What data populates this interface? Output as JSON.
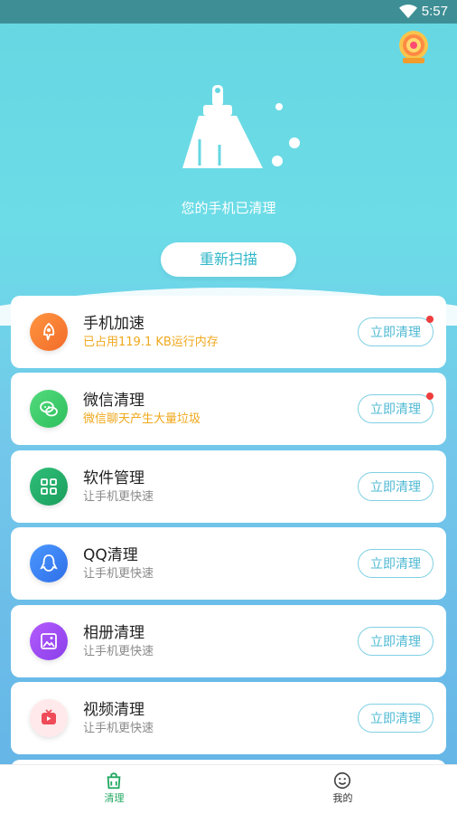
{
  "status_bar": {
    "time": "5:57"
  },
  "header": {
    "status_text": "您的手机已清理",
    "rescan_label": "重新扫描"
  },
  "items": [
    {
      "title": "手机加速",
      "subtitle": "已占用119.1 KB运行内存",
      "action": "立即清理",
      "badge": true,
      "icon": "rocket-icon",
      "color": "#f2782f"
    },
    {
      "title": "微信清理",
      "subtitle": "微信聊天产生大量垃圾",
      "action": "立即清理",
      "badge": true,
      "icon": "wechat-icon",
      "color": "#35c96a"
    },
    {
      "title": "软件管理",
      "subtitle": "让手机更快速",
      "action": "立即清理",
      "badge": false,
      "icon": "grid-icon",
      "color": "#21aa6a"
    },
    {
      "title": "QQ清理",
      "subtitle": "让手机更快速",
      "action": "立即清理",
      "badge": false,
      "icon": "qq-icon",
      "color": "#3d83f4"
    },
    {
      "title": "相册清理",
      "subtitle": "让手机更快速",
      "action": "立即清理",
      "badge": false,
      "icon": "gallery-icon",
      "color": "#9d4cf4"
    },
    {
      "title": "视频清理",
      "subtitle": "让手机更快速",
      "action": "立即清理",
      "badge": false,
      "icon": "tv-icon",
      "color": "#ef4b58"
    }
  ],
  "nav": {
    "clean_label": "清理",
    "mine_label": "我的"
  },
  "colors": {
    "accent": "#31b7c8",
    "warning_text": "#f0a81e",
    "active_nav": "#23a862",
    "badge": "#ef3d3d"
  }
}
